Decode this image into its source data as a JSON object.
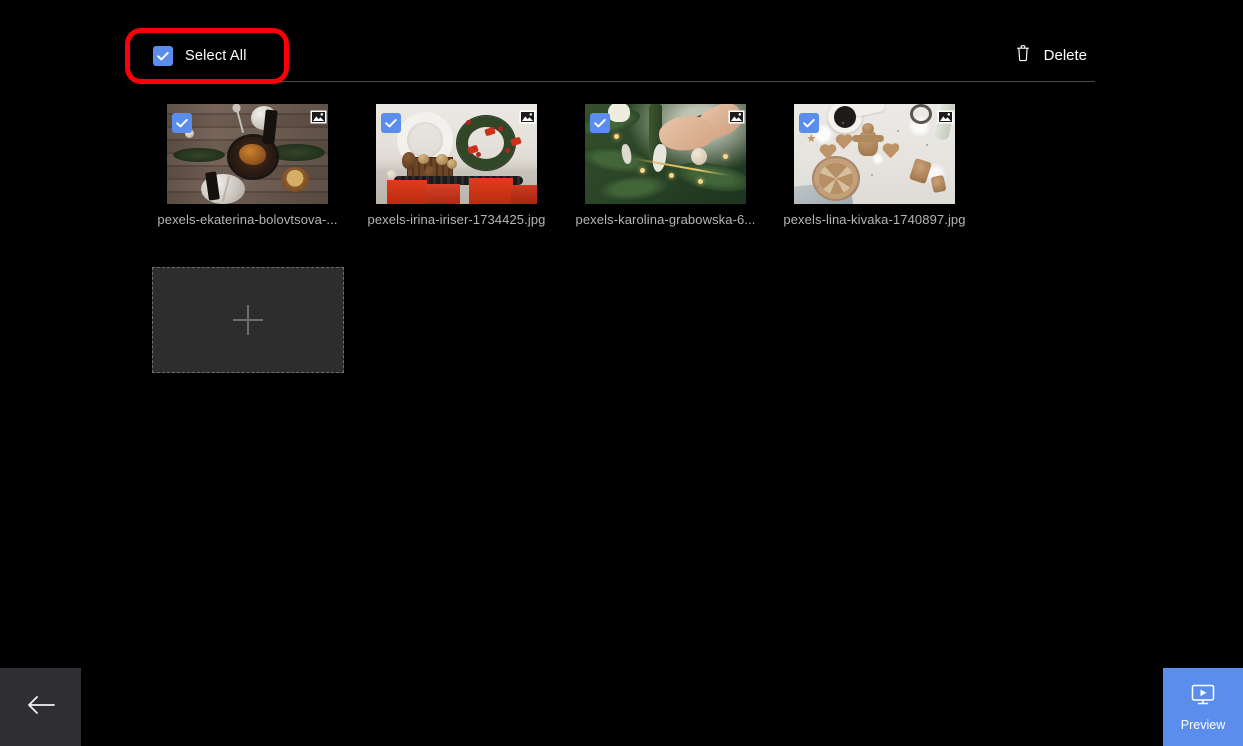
{
  "header": {
    "select_all_label": "Select All",
    "select_all_checked": true,
    "delete_label": "Delete",
    "delete_icon": "trash-icon",
    "checkbox_color": "#5b8ded"
  },
  "annotation": {
    "type": "highlight-rect",
    "color": "#fb0007",
    "target": "select-all-checkbox"
  },
  "media": {
    "badge_icon": "image-badge-icon",
    "items": [
      {
        "filename": "pexels-ekaterina-bolovtsova-...",
        "selected": true,
        "art": "art1"
      },
      {
        "filename": "pexels-irina-iriser-1734425.jpg",
        "selected": true,
        "art": "art2"
      },
      {
        "filename": "pexels-karolina-grabowska-6...",
        "selected": true,
        "art": "art3"
      },
      {
        "filename": "pexels-lina-kivaka-1740897.jpg",
        "selected": true,
        "art": "art4"
      }
    ],
    "add_tile": {
      "icon": "plus-icon",
      "label": ""
    }
  },
  "footer": {
    "back": {
      "icon": "arrow-left-icon",
      "label": ""
    },
    "preview": {
      "icon": "monitor-play-icon",
      "label": "Preview",
      "color": "#5b8ded"
    }
  }
}
